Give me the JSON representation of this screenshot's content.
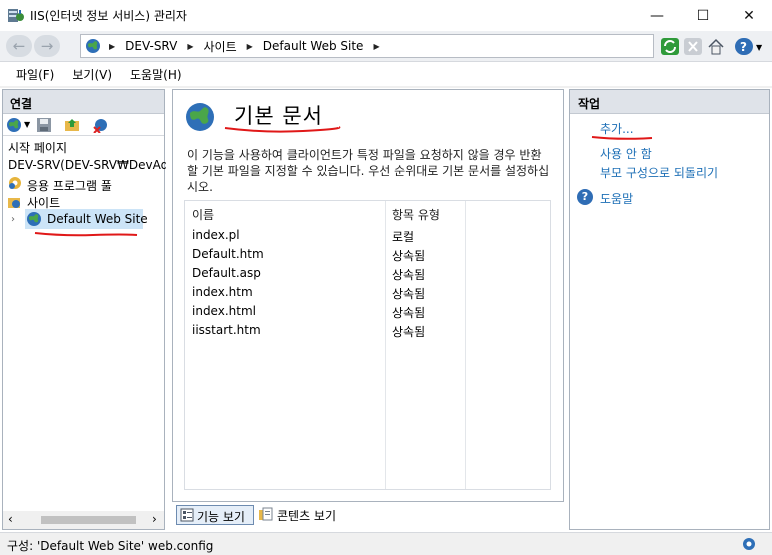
{
  "window": {
    "title": "IIS(인터넷 정보 서비스) 관리자",
    "minimize_glyph": "—",
    "maximize_glyph": "☐",
    "close_glyph": "✕"
  },
  "nav": {
    "back_glyph": "←",
    "forward_glyph": "→",
    "breadcrumbs": [
      "DEV-SRV",
      "사이트",
      "Default Web Site"
    ],
    "sep_glyph": "▶",
    "toolbar_icons": [
      "refresh-icon",
      "stop-icon",
      "home-icon",
      "help-icon"
    ]
  },
  "menu": {
    "items": [
      "파일(F)",
      "보기(V)",
      "도움말(H)"
    ]
  },
  "connections": {
    "header": "연결",
    "tree": [
      "시작 페이지",
      "DEV-SRV(DEV-SRV₩DevAdm",
      "응용 프로그램 풀",
      "사이트",
      "Default Web Site"
    ],
    "scroll_left": "‹",
    "scroll_right": "›"
  },
  "feature": {
    "title": "기본 문서",
    "description": "이 기능을 사용하여 클라이언트가 특정 파일을 요청하지 않을 경우 반환할 기본 파일을 지정할 수 있습니다. 우선 순위대로 기본 문서를 설정하십시오.",
    "columns": [
      "이름",
      "항목 유형"
    ],
    "rows": [
      {
        "name": "index.pl",
        "type": "로컬"
      },
      {
        "name": "Default.htm",
        "type": "상속됨"
      },
      {
        "name": "Default.asp",
        "type": "상속됨"
      },
      {
        "name": "index.htm",
        "type": "상속됨"
      },
      {
        "name": "index.html",
        "type": "상속됨"
      },
      {
        "name": "iisstart.htm",
        "type": "상속됨"
      }
    ]
  },
  "views": {
    "features_view": "기능 보기",
    "content_view": "콘텐츠 보기"
  },
  "actions": {
    "header": "작업",
    "items": [
      "추가...",
      "사용 안 함",
      "부모 구성으로 되돌리기"
    ],
    "help": "도움말"
  },
  "status": {
    "text": "구성: 'Default Web Site' web.config"
  },
  "colors": {
    "link": "#1d6fb6",
    "annotation": "#e01818",
    "pane_header": "#dfe3e9"
  }
}
